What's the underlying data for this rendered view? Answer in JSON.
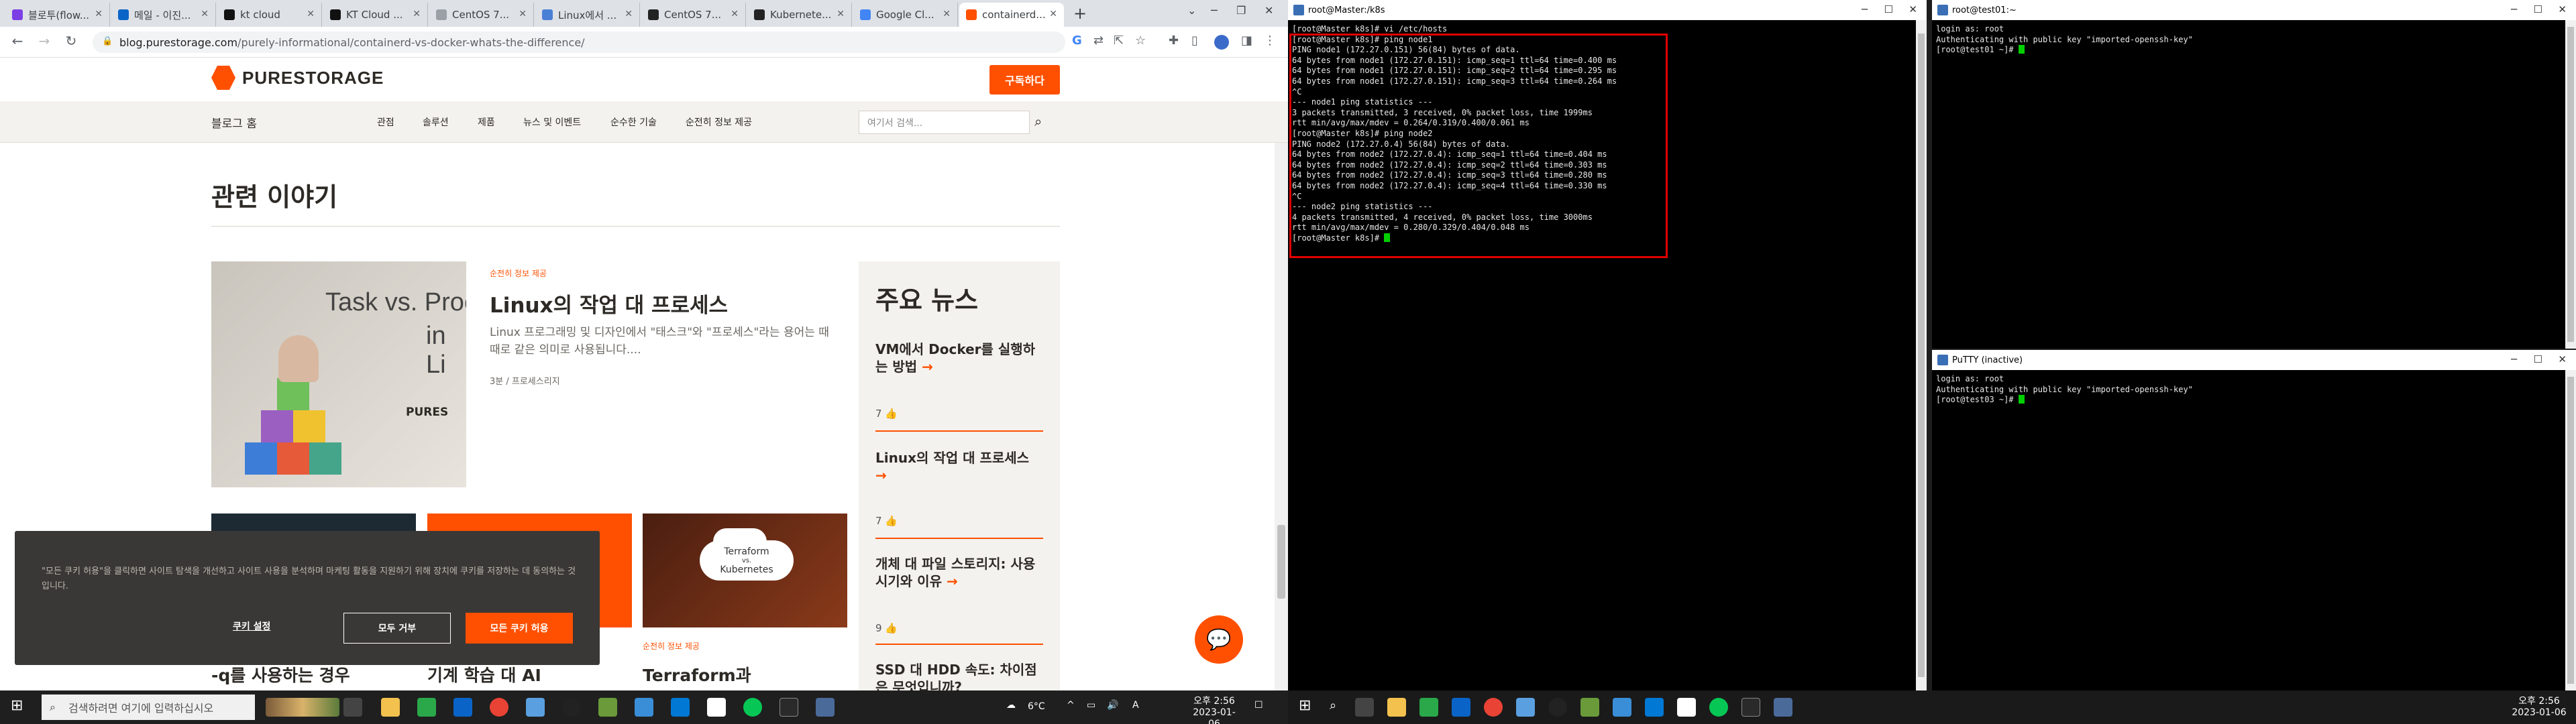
{
  "chrome": {
    "tabs": [
      {
        "label": "블로투(flow...",
        "icon": "flow-icon",
        "color": "#7b3fe4"
      },
      {
        "label": "메일 - 이진...",
        "icon": "outlook-icon",
        "color": "#0a64c8"
      },
      {
        "label": "kt cloud",
        "icon": "kt-icon",
        "color": "#111111"
      },
      {
        "label": "KT Cloud ...",
        "icon": "kt-icon",
        "color": "#111111"
      },
      {
        "label": "CentOS 7...",
        "icon": "web-icon",
        "color": "#9aa0a6"
      },
      {
        "label": "Linux에서 ...",
        "icon": "web-icon",
        "color": "#4a7fd6"
      },
      {
        "label": "CentOS 7...",
        "icon": "tistory-icon",
        "color": "#222222"
      },
      {
        "label": "Kubernete...",
        "icon": "github-icon",
        "color": "#222222"
      },
      {
        "label": "Google Cl...",
        "icon": "gcloud-icon",
        "color": "#4285f4"
      },
      {
        "label": "containerd...",
        "icon": "purestorage-icon",
        "color": "#fe5000"
      }
    ],
    "url": {
      "host": "blog.purestorage.com",
      "path": "/purely-informational/containerd-vs-docker-whats-the-difference/"
    }
  },
  "site": {
    "logo": "PURESTORAGE",
    "cta": "구독하다",
    "blog_home": "블로그 홈",
    "nav": [
      "관점",
      "솔루션",
      "제품",
      "뉴스 및 이벤트",
      "순수한 기술",
      "순전히 정보 제공"
    ],
    "search_placeholder": "여기서 검색...",
    "related_heading": "관련 이야기",
    "feature": {
      "image_text_1": "Task vs. Proc",
      "image_text_2": "in Li",
      "image_brand": "PURES",
      "category": "순전히 정보 제공",
      "title": "Linux의 작업 대 프로세스",
      "desc": "Linux 프로그래밍 및 디자인에서 \"태스크\"와 \"프로세스\"라는 용어는 때때로 같은 의미로 사용됩니다....",
      "meta": "3분  /  프로세스리지"
    },
    "news": {
      "heading": "주요 뉴스",
      "items": [
        {
          "title": "VM에서 Docker를 실행하는 방법",
          "likes": "7"
        },
        {
          "title": "Linux의 작업 대 프로세스",
          "likes": "7"
        },
        {
          "title": "개체 대 파일 스토리지: 사용 시기와 이유",
          "likes": "9"
        },
        {
          "title": "SSD 대 HDD 속도: 차이점은 무엇입니까?",
          "likes": ""
        }
      ]
    },
    "cards": [
      {
        "title": "-q를 사용하는 경우",
        "category": ""
      },
      {
        "title": "기계 학습 대 AI",
        "category": ""
      },
      {
        "title": "Terraform과",
        "category": "순전히 정보 제공",
        "img_top": "Terraform",
        "img_mid": "vs.",
        "img_bot": "Kubernetes"
      }
    ],
    "cookie": {
      "text": "\"모든 쿠키 허용\"을 클릭하면 사이트 탐색을 개선하고 사이트 사용을 분석하며 마케팅 활동을 지원하기 위해 장치에 쿠키를 저장하는 데 동의하는 것입니다.",
      "settings": "쿠키 설정",
      "reject": "모두 거부",
      "accept": "모든 쿠키 허용"
    }
  },
  "taskbar_left": {
    "search_placeholder": "검색하려면 여기에 입력하십시오",
    "weather": "6°C",
    "ime": "A",
    "time": "오후 2:56",
    "date": "2023-01-06"
  },
  "taskbar_right": {
    "time": "오후 2:56",
    "date": "2023-01-06"
  },
  "term_main": {
    "title": "root@Master:/k8s",
    "lines": [
      "[root@Master k8s]# vi /etc/hosts",
      "[root@Master k8s]# ping node1",
      "PING node1 (172.27.0.151) 56(84) bytes of data.",
      "64 bytes from node1 (172.27.0.151): icmp_seq=1 ttl=64 time=0.400 ms",
      "64 bytes from node1 (172.27.0.151): icmp_seq=2 ttl=64 time=0.295 ms",
      "64 bytes from node1 (172.27.0.151): icmp_seq=3 ttl=64 time=0.264 ms",
      "^C",
      "--- node1 ping statistics ---",
      "3 packets transmitted, 3 received, 0% packet loss, time 1999ms",
      "rtt min/avg/max/mdev = 0.264/0.319/0.400/0.061 ms",
      "[root@Master k8s]# ping node2",
      "PING node2 (172.27.0.4) 56(84) bytes of data.",
      "64 bytes from node2 (172.27.0.4): icmp_seq=1 ttl=64 time=0.404 ms",
      "64 bytes from node2 (172.27.0.4): icmp_seq=2 ttl=64 time=0.303 ms",
      "64 bytes from node2 (172.27.0.4): icmp_seq=3 ttl=64 time=0.280 ms",
      "64 bytes from node2 (172.27.0.4): icmp_seq=4 ttl=64 time=0.330 ms",
      "^C",
      "--- node2 ping statistics ---",
      "4 packets transmitted, 4 received, 0% packet loss, time 3000ms",
      "rtt min/avg/max/mdev = 0.280/0.329/0.404/0.048 ms"
    ],
    "prompt": "[root@Master k8s]# "
  },
  "term_top": {
    "title": "root@test01:~",
    "lines": [
      "login as: root",
      "Authenticating with public key \"imported-openssh-key\""
    ],
    "prompt": "[root@test01 ~]# "
  },
  "term_bottom": {
    "title": "PuTTY (inactive)",
    "lines": [
      "login as: root",
      "Authenticating with public key \"imported-openssh-key\""
    ],
    "prompt": "[root@test03 ~]# "
  }
}
